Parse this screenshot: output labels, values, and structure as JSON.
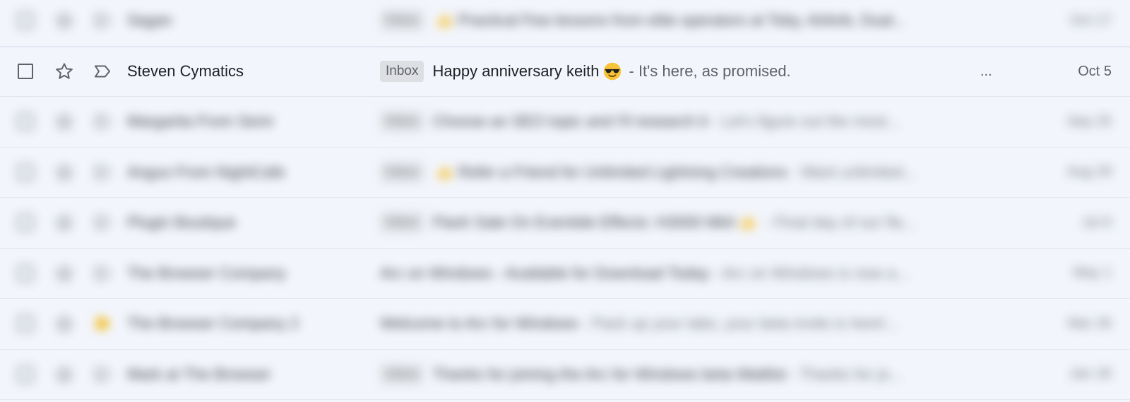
{
  "emails": [
    {
      "sender": "Sagan",
      "label": "Inbox",
      "subject_emoji": "thumbs-up",
      "subject": "Practical Few lessons from elite operators at Toby, Airbnb, Dual...",
      "snippet": "",
      "date": "Oct 17",
      "starred": false,
      "blurred": true
    },
    {
      "sender": "Steven Cymatics",
      "label": "Inbox",
      "subject": "Happy anniversary keith",
      "subject_emoji_after": "sunglasses-face",
      "snippet": "- It's here, as promised.",
      "trailing": "...",
      "date": "Oct 5",
      "starred": false,
      "blurred": false
    },
    {
      "sender": "Margarita From Semi",
      "label": "Inbox",
      "subject": "Choose an SEO topic and I'll research it",
      "snippet": "- Let's figure out the most...",
      "date": "Sep 25",
      "starred": false,
      "blurred": true
    },
    {
      "sender": "Angus From NightCafe",
      "label": "Inbox",
      "subject_emoji": "thumbs-up",
      "subject": "Refer a Friend for Unlimited Lightning Creations",
      "snippet": "- Want unlimited...",
      "date": "Aug 29",
      "starred": false,
      "blurred": true
    },
    {
      "sender": "Plugin Boutique",
      "label": "Inbox",
      "subject": "Flash Sale On Eventide Effects: H3000 MkII",
      "subject_emoji_after": "thumbs-up",
      "snippet": "- Final day of our fla...",
      "date": "Jul 6",
      "starred": false,
      "blurred": true
    },
    {
      "sender": "The Browser Company",
      "label": "",
      "subject": "Arc on Windows - Available for Download Today",
      "snippet": "- Arc on Windows is now a...",
      "date": "May 1",
      "starred": false,
      "blurred": true
    },
    {
      "sender": "The Browser Company 2",
      "label": "",
      "subject": "Welcome to Arc for Windows",
      "snippet": "- Pack up your tabs, your beta invite is here!...",
      "date": "Mar 26",
      "starred": true,
      "blurred": true
    },
    {
      "sender": "Mark at The Browser",
      "label": "Inbox",
      "subject": "Thanks for joining the Arc for Windows beta Waitlist",
      "snippet": "- Thanks for jo...",
      "date": "Jan 26",
      "starred": false,
      "blurred": true
    }
  ],
  "colors": {
    "background": "#f2f5fc",
    "text": "#202124",
    "muted": "#5f6368",
    "chip": "#dddfe3",
    "star": "#f4b400"
  }
}
